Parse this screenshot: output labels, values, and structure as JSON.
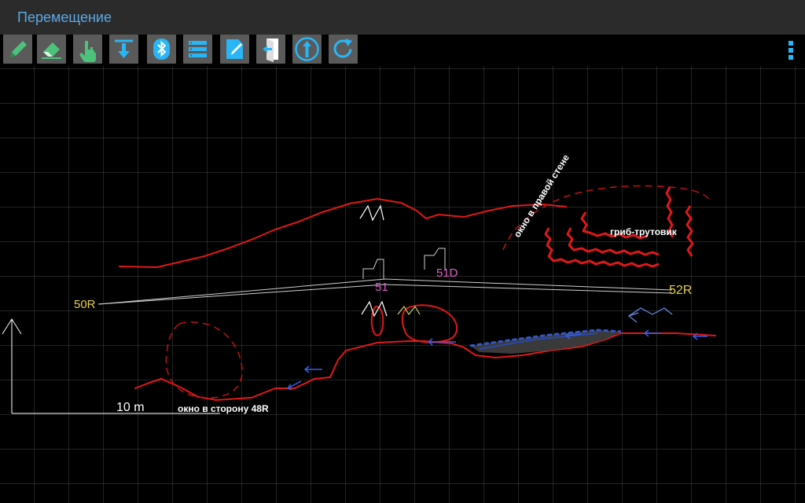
{
  "app": {
    "title": "Перемещение"
  },
  "toolbar": {
    "buttons": [
      {
        "icon": "pencil-icon"
      },
      {
        "icon": "eraser-icon"
      },
      {
        "icon": "hand-pointer-icon"
      },
      {
        "icon": "download-arrow-icon"
      },
      {
        "icon": "bluetooth-icon"
      },
      {
        "icon": "list-icon"
      },
      {
        "icon": "note-edit-icon"
      },
      {
        "icon": "exit-door-icon"
      },
      {
        "icon": "up-arrow-circle-icon"
      },
      {
        "icon": "refresh-icon"
      }
    ],
    "overflow_icon": "more-vertical-icon"
  },
  "sketch": {
    "stations": [
      "50R",
      "51",
      "51D",
      "52R"
    ],
    "labels": {
      "fungus": "гриб-трутовик",
      "window_right": "окно в правой стене",
      "window_48r": "окно в сторону 48R"
    },
    "scale": "10 m",
    "colors": {
      "background": "#000000",
      "grid": "#4a4a4a",
      "wall": "#e01818",
      "station": "#e8d24a",
      "station_pink": "#e060c8",
      "water": "#2a4aa8",
      "text": "#ffffff"
    }
  }
}
